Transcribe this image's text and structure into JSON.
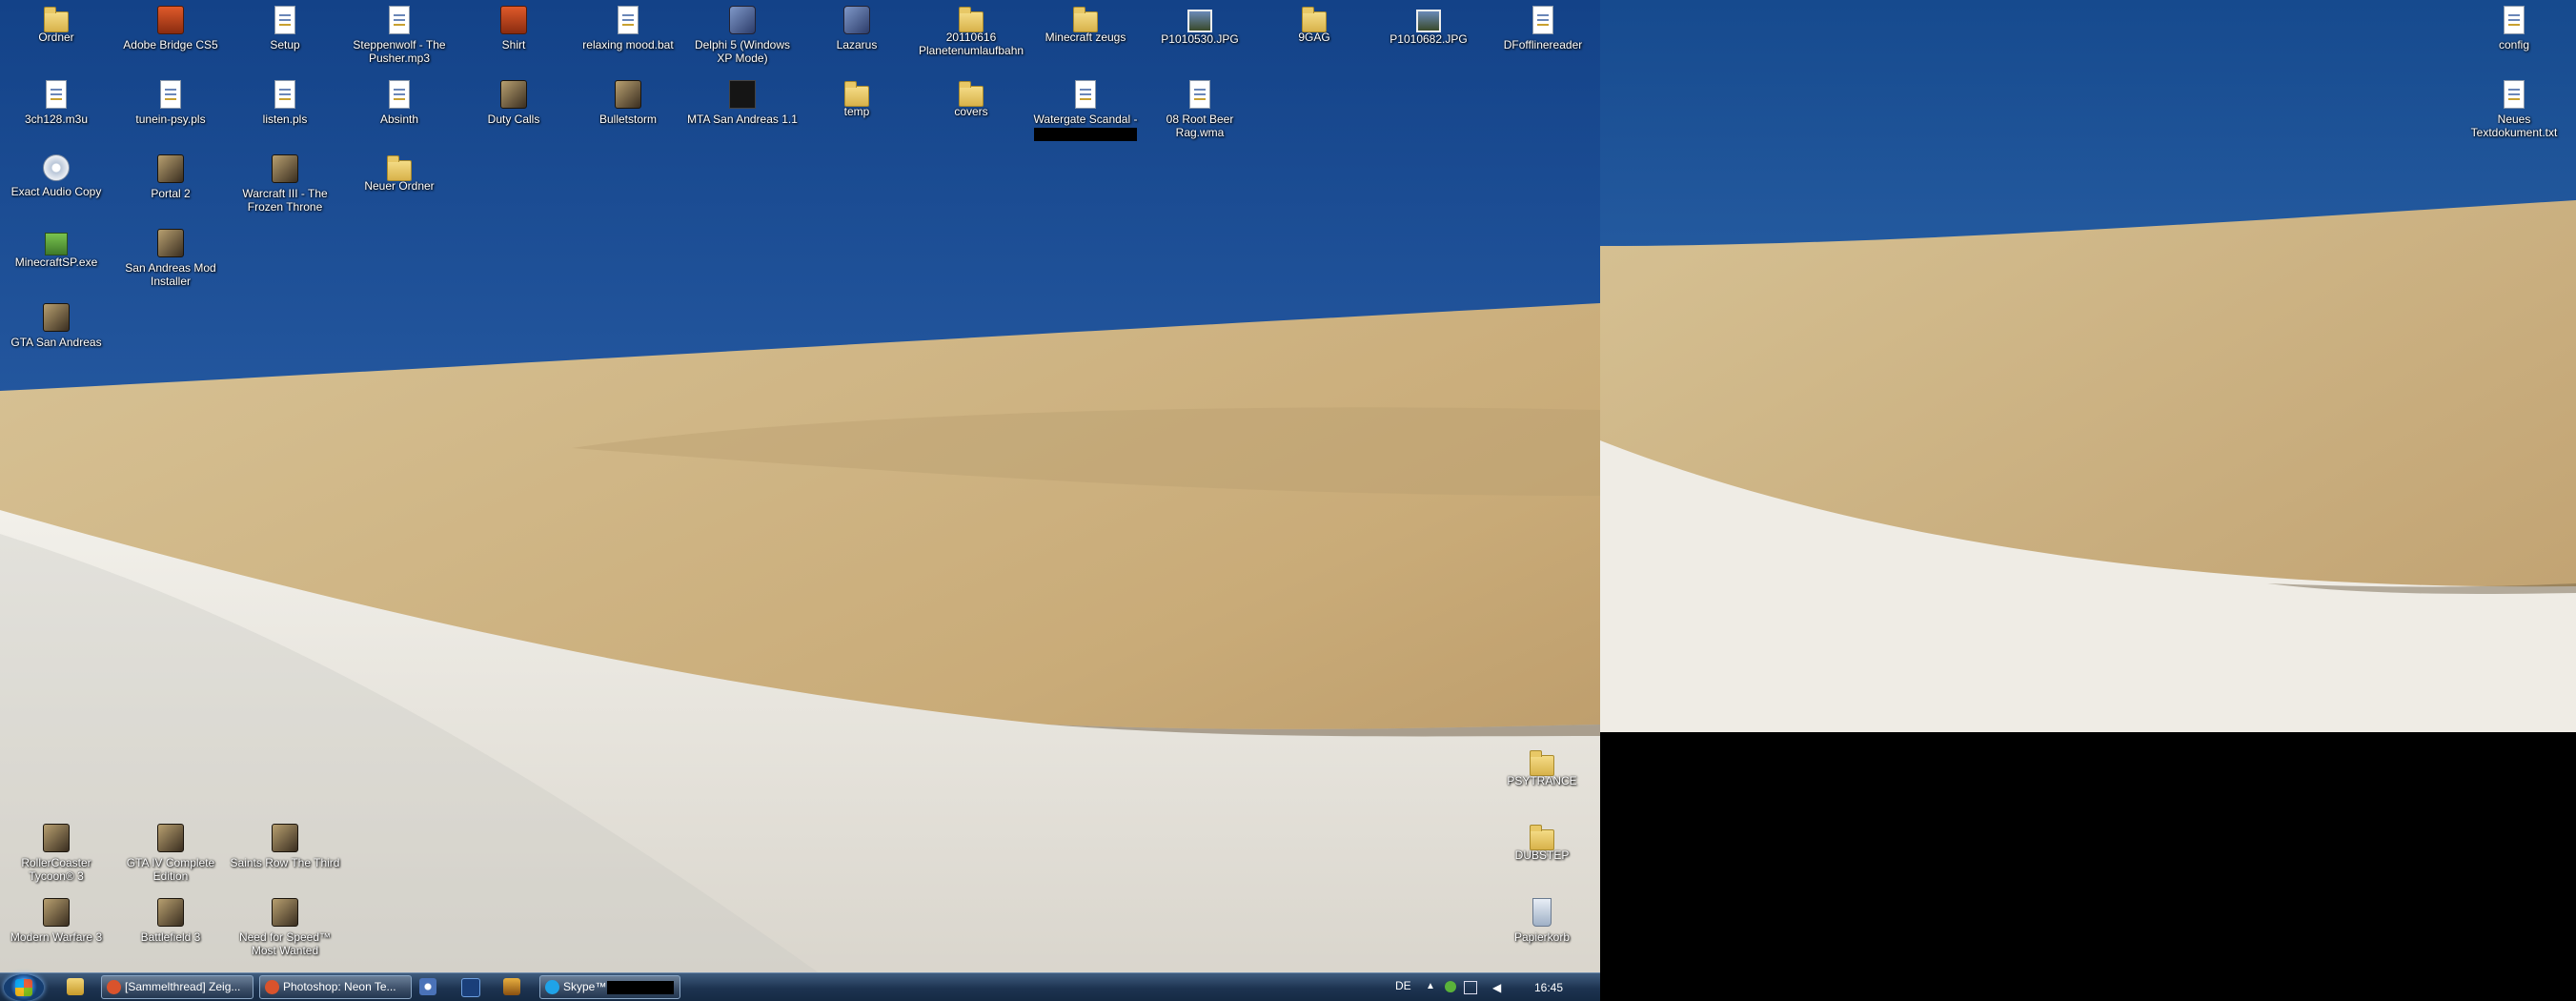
{
  "desktop1_icons": [
    {
      "label": "Ordner",
      "col": 0,
      "row": 0,
      "type": "folder"
    },
    {
      "label": "Adobe Bridge CS5",
      "col": 1,
      "row": 0,
      "type": "red"
    },
    {
      "label": "Setup",
      "col": 2,
      "row": 0,
      "type": "file"
    },
    {
      "label": "Steppenwolf - The Pusher.mp3",
      "col": 3,
      "row": 0,
      "type": "file"
    },
    {
      "label": "Shirt",
      "col": 4,
      "row": 0,
      "type": "red"
    },
    {
      "label": "relaxing mood.bat",
      "col": 5,
      "row": 0,
      "type": "file"
    },
    {
      "label": "Delphi 5 (Windows XP Mode)",
      "col": 6,
      "row": 0,
      "type": "app"
    },
    {
      "label": "Lazarus",
      "col": 7,
      "row": 0,
      "type": "app"
    },
    {
      "label": "20110616 Planetenumlaufbahn",
      "col": 8,
      "row": 0,
      "type": "folder"
    },
    {
      "label": "Minecraft zeugs",
      "col": 9,
      "row": 0,
      "type": "folder"
    },
    {
      "label": "P1010530.JPG",
      "col": 10,
      "row": 0,
      "type": "photo"
    },
    {
      "label": "9GAG",
      "col": 11,
      "row": 0,
      "type": "folder"
    },
    {
      "label": "P1010682.JPG",
      "col": 12,
      "row": 0,
      "type": "photo"
    },
    {
      "label": "DFofflinereader",
      "col": 13,
      "row": 0,
      "type": "file"
    },
    {
      "label": "3ch128.m3u",
      "col": 0,
      "row": 1,
      "type": "file"
    },
    {
      "label": "tunein-psy.pls",
      "col": 1,
      "row": 1,
      "type": "file"
    },
    {
      "label": "listen.pls",
      "col": 2,
      "row": 1,
      "type": "file"
    },
    {
      "label": "Absinth",
      "col": 3,
      "row": 1,
      "type": "file"
    },
    {
      "label": "Duty Calls",
      "col": 4,
      "row": 1,
      "type": "game"
    },
    {
      "label": "Bulletstorm",
      "col": 5,
      "row": 1,
      "type": "game"
    },
    {
      "label": "MTA San Andreas 1.1",
      "col": 6,
      "row": 1,
      "type": "dark"
    },
    {
      "label": "temp",
      "col": 7,
      "row": 1,
      "type": "folder"
    },
    {
      "label": "covers",
      "col": 8,
      "row": 1,
      "type": "folder"
    },
    {
      "label": "Watergate Scandal -",
      "col": 9,
      "row": 1,
      "type": "file",
      "redacted": true
    },
    {
      "label": "08 Root Beer Rag.wma",
      "col": 10,
      "row": 1,
      "type": "file"
    },
    {
      "label": "Exact Audio Copy",
      "col": 0,
      "row": 2,
      "type": "disc"
    },
    {
      "label": "Portal 2",
      "col": 1,
      "row": 2,
      "type": "game"
    },
    {
      "label": "Warcraft III - The Frozen Throne",
      "col": 2,
      "row": 2,
      "type": "game"
    },
    {
      "label": "Neuer Ordner",
      "col": 3,
      "row": 2,
      "type": "folder"
    },
    {
      "label": "MinecraftSP.exe",
      "col": 0,
      "row": 3,
      "type": "green"
    },
    {
      "label": "San Andreas Mod Installer",
      "col": 1,
      "row": 3,
      "type": "game"
    },
    {
      "label": "GTA San Andreas",
      "col": 0,
      "row": 4,
      "type": "game"
    }
  ],
  "desktop1_bottom_icons": [
    {
      "label": "RollerCoaster Tycoon® 3",
      "col": 0,
      "row": 0,
      "type": "game"
    },
    {
      "label": "GTA IV Complete Edition",
      "col": 1,
      "row": 0,
      "type": "game"
    },
    {
      "label": "Saints Row The Third",
      "col": 2,
      "row": 0,
      "type": "game"
    },
    {
      "label": "Modern Warfare 3",
      "col": 0,
      "row": 1,
      "type": "game"
    },
    {
      "label": "Battlefield 3",
      "col": 1,
      "row": 1,
      "type": "game"
    },
    {
      "label": "Need for Speed™ Most Wanted",
      "col": 2,
      "row": 1,
      "type": "game"
    }
  ],
  "desktop1_right_icons": [
    {
      "label": "PSYTRANCE",
      "row": 0,
      "type": "folder"
    },
    {
      "label": "DUBSTEP",
      "row": 1,
      "type": "folder"
    },
    {
      "label": "Papierkorb",
      "row": 2,
      "type": "bin"
    }
  ],
  "desktop2_icons": [
    {
      "label": "config",
      "row": 0,
      "type": "file"
    },
    {
      "label": "Neues Textdokument.txt",
      "row": 1,
      "type": "file"
    }
  ],
  "taskbar": {
    "buttons": [
      {
        "label": "[Sammelthread] Zeig...",
        "icon_color": "#d9532c"
      },
      {
        "label": "Photoshop: Neon Te...",
        "icon_color": "#d9532c"
      },
      {
        "label": "Skype™",
        "icon_color": "#1fa3e8",
        "redacted": true
      }
    ],
    "quick_launch": [
      "explorer-icon",
      "media-player-icon",
      "photoshop-icon",
      "winamp-icon"
    ],
    "language": "DE",
    "clock": "16:45"
  },
  "colors": {
    "sky_top": "#1a4b8e",
    "sky_bottom": "#3f79c2",
    "sand": "#cdb585",
    "snow": "#ece9e2"
  }
}
